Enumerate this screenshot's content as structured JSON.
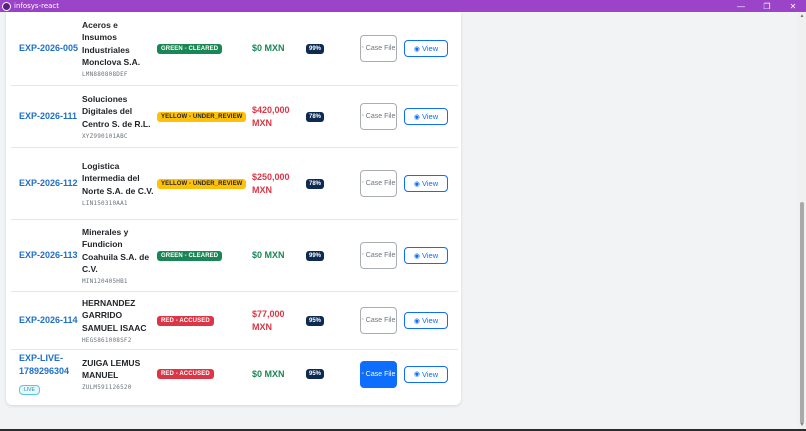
{
  "window": {
    "title": "infosys-react",
    "controls": {
      "minimize": "—",
      "maximize": "❐",
      "close": "✕"
    }
  },
  "rows": [
    {
      "id": "EXP-2026-005",
      "company": "Aceros e Insumos Industriales Monclova S.A.",
      "rfc": "LMN880808DEF",
      "risk": "GREEN - CLEARED",
      "amount": "$0 MXN",
      "confidence": "99%",
      "case_label": "Case File",
      "view_label": "View"
    },
    {
      "id": "EXP-2026-111",
      "company": "Soluciones Digitales del Centro S. de R.L.",
      "rfc": "XYZ990101ABC",
      "risk": "YELLOW - UNDER_REVIEW",
      "amount": "$420,000 MXN",
      "confidence": "78%",
      "case_label": "Case File",
      "view_label": "View"
    },
    {
      "id": "EXP-2026-112",
      "company": "Logistica Intermedia del Norte S.A. de C.V.",
      "rfc": "LIN150310AA1",
      "risk": "YELLOW - UNDER_REVIEW",
      "amount": "$250,000 MXN",
      "confidence": "78%",
      "case_label": "Case File",
      "view_label": "View"
    },
    {
      "id": "EXP-2026-113",
      "company": "Minerales y Fundicion Coahuila S.A. de C.V.",
      "rfc": "MIN120405HB1",
      "risk": "GREEN - CLEARED",
      "amount": "$0 MXN",
      "confidence": "99%",
      "case_label": "Case File",
      "view_label": "View"
    },
    {
      "id": "EXP-2026-114",
      "company": "HERNANDEZ GARRIDO SAMUEL ISAAC",
      "rfc": "HEGS861008SF2",
      "risk": "RED - ACCUSED",
      "amount": "$77,000 MXN",
      "confidence": "95%",
      "case_label": "Case File",
      "view_label": "View"
    },
    {
      "id": "EXP-LIVE-1789296304",
      "live_badge": "LIVE",
      "company": "ZUIGA LEMUS MANUEL",
      "rfc": "ZULM591126520",
      "risk": "RED - ACCUSED",
      "amount": "$0 MXN",
      "confidence": "95%",
      "case_label": "Case File",
      "view_label": "View"
    }
  ],
  "colors": {
    "titlebar": "#9b43c9",
    "link_blue": "#1e6fc8",
    "risk_green": "#198754",
    "risk_yellow": "#ffc107",
    "risk_red": "#dc3545",
    "confidence_badge": "#0d2b52",
    "primary": "#0d6efd"
  },
  "icons": {
    "case_file": "document-icon",
    "view": "eye-icon"
  }
}
